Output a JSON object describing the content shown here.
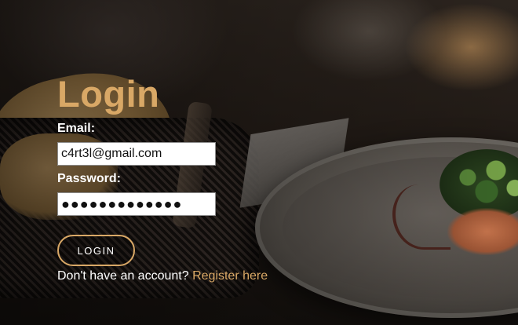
{
  "login": {
    "title": "Login",
    "email_label": "Email:",
    "email_value": "c4rt3l@gmail.com",
    "password_label": "Password:",
    "password_masked": "●●●●●●●●●●●●●",
    "login_button": "LOGIN",
    "register_prompt": "Don't have an account?",
    "register_link": "Register here"
  },
  "colors": {
    "accent": "#d9a866",
    "text": "#ffffff",
    "field_bg": "#ffffff"
  }
}
